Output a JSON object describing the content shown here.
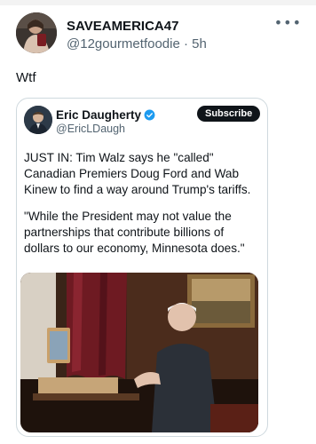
{
  "post": {
    "author_name": "SAVEAMERICA47",
    "author_handle_time": "@12gourmetfoodie · 5h",
    "more_icon": "ellipsis-icon",
    "text": "Wtf"
  },
  "quote": {
    "name": "Eric Daugherty",
    "handle": "@EricLDaugh",
    "verified_color": "#1d9bf0",
    "subscribe_label": "Subscribe",
    "paragraph1": "JUST IN: Tim Walz says he \"called\" Canadian Premiers Doug Ford and Wab Kinew to find a way around Trump's tariffs.",
    "paragraph2": "\"While the President may not value the partnerships that contribute billions of dollars to our economy, Minnesota does.\""
  }
}
